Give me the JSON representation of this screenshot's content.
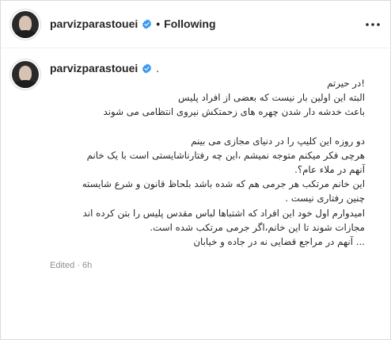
{
  "post": {
    "author": {
      "username": "parvizparastouei",
      "verified": true
    },
    "follow_status": "Following",
    "separator": "•",
    "more_options_icon": "more-horizontal-icon",
    "caption": {
      "username": "parvizparastouei",
      "trailing": ".",
      "lines": [
        "!در حیرتم",
        "البته این اولین بار نیست که بعضی از افراد پلیس",
        "باعث خدشه دار شدن چهره های زحمتکش نیروی انتظامی می شوند",
        "",
        "دو روزه این کلیپ را در دنیای مجازی می بینم",
        "هرچی فکر میکنم متوجه نمیشم ،این چه رفتارناشایستی است با یک خانم",
        "آنهم در ملاء عام؟.",
        "این خانم مرتکب هر جرمی هم که شده باشد بلحاظ قانون و شرع شایسته",
        "چنین رفتاری نیست .",
        "امیدوارم اول خود این افراد که اشتباها لباس مقدس پلیس را بتن کرده اند",
        "مجازات شوند تا این خانم،اگر جرمی مرتکب شده است.",
        "... آنهم در مراجع قضایی نه در جاده و خیابان"
      ]
    },
    "meta": {
      "edited_label": "Edited",
      "separator": "·",
      "time": "6h"
    }
  },
  "colors": {
    "verified_blue": "#3897f0",
    "text": "#262626",
    "muted": "#8e8e8e",
    "border": "#dbdbdb"
  }
}
